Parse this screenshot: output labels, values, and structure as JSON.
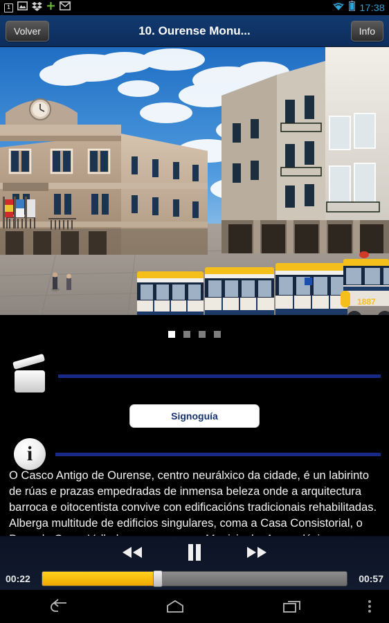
{
  "statusbar": {
    "icons": [
      "notification-count-icon",
      "gallery-icon",
      "dropbox-icon",
      "plus-icon",
      "gmail-icon"
    ],
    "notification_count": "1",
    "wifi_icon": "wifi-icon",
    "battery_icon": "battery-icon",
    "clock": "17:38",
    "clock_color": "#2ea3d8"
  },
  "appbar": {
    "back_label": "Volver",
    "title": "10. Ourense Monu...",
    "info_label": "Info",
    "background_color": "#123a70"
  },
  "hero": {
    "alt": "Praza Maior de Ourense coa Casa Consistorial e tren turístico",
    "sky_color": "#2f7fd0",
    "building_color": "#b9a08a",
    "train_roof_color": "#f5bf1b",
    "train_body_color": "#1b3a6b",
    "train_number": "1887"
  },
  "carousel": {
    "total_dots": 4,
    "active_index": 0,
    "active_color": "#ffffff",
    "inactive_color": "#7d7d7d"
  },
  "sections": {
    "video": {
      "icon": "clapperboard-icon",
      "rule_color": "#162a86"
    },
    "signoguia_button": {
      "label": "Signoguía",
      "text_color": "#16306e",
      "background_color": "#ffffff"
    },
    "info": {
      "icon": "info-circle-icon",
      "glyph": "i",
      "rule_color": "#162a86"
    }
  },
  "description": {
    "text": "O Casco Antigo de Ourense, centro neurálxico da cidade, é un labirinto de rúas e prazas empedradas de inmensa beleza onde a arquitectura barroca e oitocentista convive con edificacións tradicionais rehabilitadas. Alberga multitude de edificios singulares, coma a Casa Consistorial, o Pazo de Oca – Valladares, os museos Municipal e Arqueolóxico ou as igrexas e capelas"
  },
  "player": {
    "rewind_label": "rewind-button",
    "pause_label": "pause-button",
    "forward_label": "forward-button",
    "elapsed": "00:22",
    "duration": "00:57",
    "progress_percent": 38,
    "fill_color": "#f0a800",
    "track_color": "#7d7d7d"
  },
  "navbar": {
    "back": "back-nav-icon",
    "home": "home-nav-icon",
    "recents": "recents-nav-icon",
    "menu": "overflow-menu-icon"
  }
}
